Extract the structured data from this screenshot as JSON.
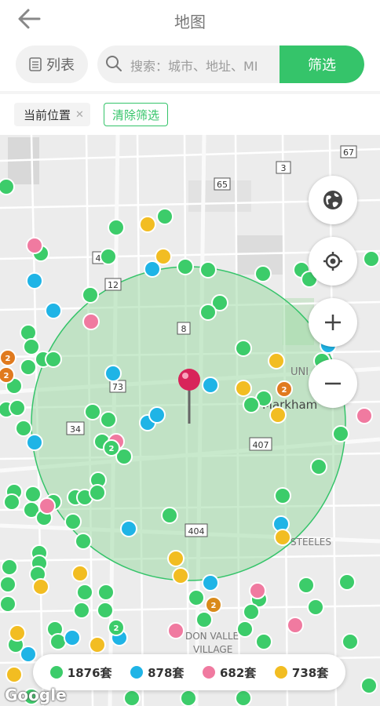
{
  "header": {
    "title": "地图",
    "back_icon": "arrow-left-icon"
  },
  "toolbar": {
    "list_label": "列表",
    "search_placeholder": "搜索：城市、地址、MI",
    "filter_label": "筛选"
  },
  "chips": {
    "current_location": "当前位置",
    "clear_filter": "清除筛选"
  },
  "map": {
    "labels": {
      "hwy_67": "67",
      "hwy_3": "3",
      "hwy_65": "65",
      "hwy_12": "12",
      "hwy_4": "4",
      "hwy_8": "8",
      "hwy_73": "73",
      "hwy_34": "34",
      "hwy_407": "407",
      "hwy_404": "404",
      "unionville": "UNI",
      "markham": "Markham",
      "steeles": "STEELES",
      "don_valley": "DON VALLE",
      "village": "VILLAGE"
    },
    "cluster_count": "2",
    "attribution": "Google"
  },
  "legend": {
    "items": [
      {
        "label": "1876套",
        "color": "#3ccc6a"
      },
      {
        "label": "878套",
        "color": "#1fb4e6"
      },
      {
        "label": "682套",
        "color": "#f07aa0"
      },
      {
        "label": "738套",
        "color": "#f2bd22"
      }
    ]
  },
  "colors": {
    "accent": "#35c46a",
    "circle_fill": "#b8e6bd",
    "pin": "#d8245a"
  }
}
